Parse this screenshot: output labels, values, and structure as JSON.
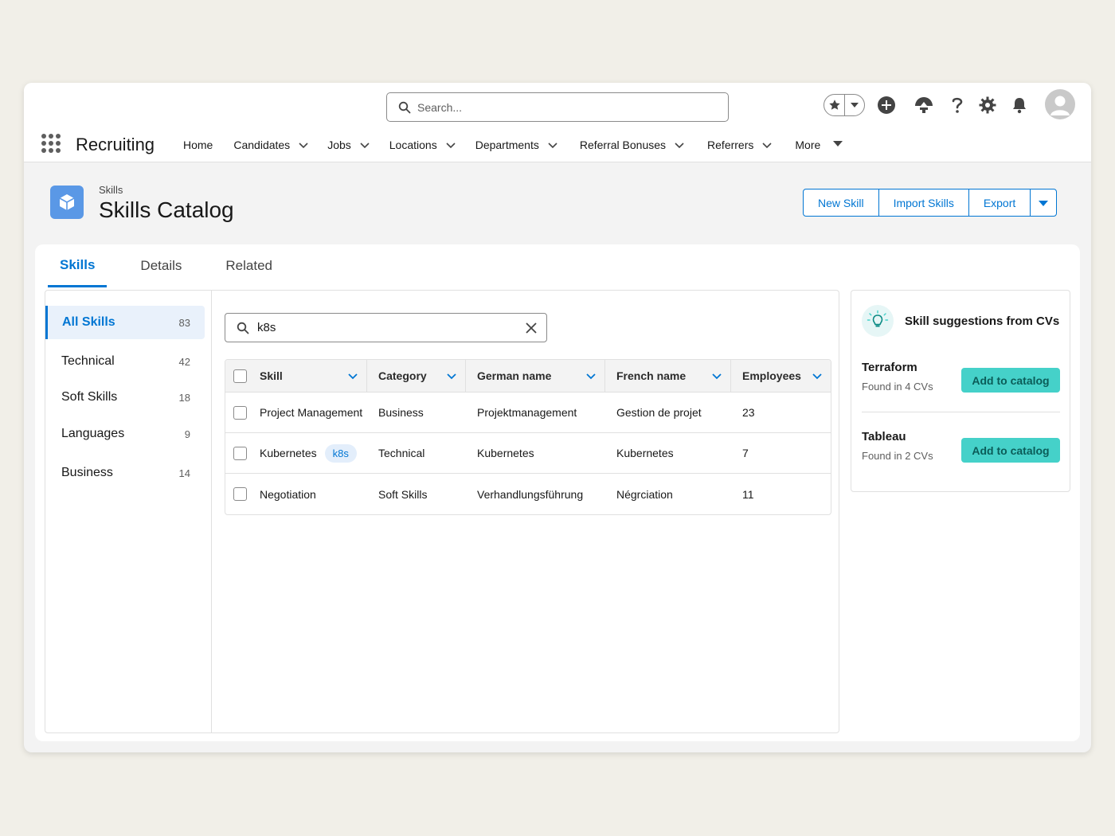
{
  "header": {
    "search_placeholder": "Search...",
    "app_name": "Recruiting",
    "nav": [
      {
        "label": "Home"
      },
      {
        "label": "Candidates"
      },
      {
        "label": "Jobs"
      },
      {
        "label": "Locations"
      },
      {
        "label": "Departments"
      },
      {
        "label": "Referral Bonuses"
      },
      {
        "label": "Referrers"
      },
      {
        "label": "More"
      }
    ]
  },
  "page": {
    "breadcrumb": "Skills",
    "title": "Skills Catalog",
    "buttons": {
      "new": "New Skill",
      "import": "Import Skills",
      "export": "Export"
    }
  },
  "tabs": [
    {
      "label": "Skills"
    },
    {
      "label": "Details"
    },
    {
      "label": "Related"
    }
  ],
  "sidebar": {
    "items": [
      {
        "label": "All Skills",
        "count": "83"
      },
      {
        "label": "Technical",
        "count": "42"
      },
      {
        "label": "Soft Skills",
        "count": "18"
      },
      {
        "label": "Languages",
        "count": "9"
      },
      {
        "label": "Business",
        "count": "14"
      }
    ]
  },
  "filter": {
    "value": "k8s"
  },
  "table": {
    "columns": [
      "Skill",
      "Category",
      "German name",
      "French name",
      "Employees"
    ],
    "rows": [
      {
        "skill": "Project Management",
        "tag": "",
        "category": "Business",
        "german": "Projektmanagement",
        "french": "Gestion de projet",
        "employees": "23"
      },
      {
        "skill": "Kubernetes",
        "tag": "k8s",
        "category": "Technical",
        "german": "Kubernetes",
        "french": "Kubernetes",
        "employees": "7"
      },
      {
        "skill": "Negotiation",
        "tag": "",
        "category": "Soft Skills",
        "german": "Verhandlungsführung",
        "french": "Négrciation",
        "employees": "11"
      }
    ]
  },
  "suggestions": {
    "title": "Skill suggestions from CVs",
    "items": [
      {
        "name": "Terraform",
        "sub": "Found in 4 CVs",
        "button": "Add to catalog"
      },
      {
        "name": "Tableau",
        "sub": "Found in 2 CVs",
        "button": "Add to catalog"
      }
    ]
  },
  "colors": {
    "brand": "#0176d3",
    "accent_teal": "#45d1c9",
    "page_icon": "#5a98e6"
  }
}
